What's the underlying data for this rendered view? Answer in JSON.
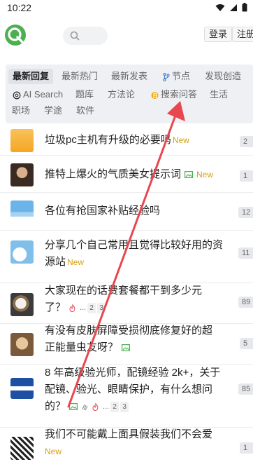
{
  "status": {
    "time": "10:22"
  },
  "header": {
    "login_label": "登录",
    "register_label": "注册"
  },
  "tabs": {
    "row1": [
      "最新回复",
      "最新热门",
      "最新发表",
      "节点",
      "发现创造"
    ],
    "row2": [
      "AI Search",
      "题库",
      "方法论",
      "搜索问答",
      "生活"
    ],
    "row3": [
      "职场",
      "学途",
      "软件"
    ]
  },
  "topics": [
    {
      "title": "垃圾pc主机有升级的必要吗",
      "new": "New",
      "count": "2"
    },
    {
      "title": "推特上爆火的气质美女提示词",
      "new": "New",
      "count": "1"
    },
    {
      "title": "各位有抢国家补贴经验吗",
      "count": "12"
    },
    {
      "title": "分享几个自己常用且觉得比较好用的资源站",
      "new": "New",
      "count": "11"
    },
    {
      "title": "大家现在的话费套餐都干到多少元了？",
      "dots": "...",
      "pages": [
        "2",
        "3"
      ],
      "count": "89"
    },
    {
      "title": "有没有皮肤屏障受损彻底修复好的超正能量虫友呀？",
      "count": "5"
    },
    {
      "title": "8 年高级验光师，配镜经验 2k+，关于配镜、验光、眼睛保护，有什么想问的？",
      "dots": "...",
      "pages": [
        "2",
        "3"
      ],
      "count": "85"
    },
    {
      "title": "我们不可能戴上面具假装我们不会爱",
      "new": "New",
      "count": "1"
    }
  ],
  "colors": {
    "accent": "#4caf50",
    "new": "#d4a016",
    "arrow": "#e8474f",
    "fire": "#e8474f"
  }
}
